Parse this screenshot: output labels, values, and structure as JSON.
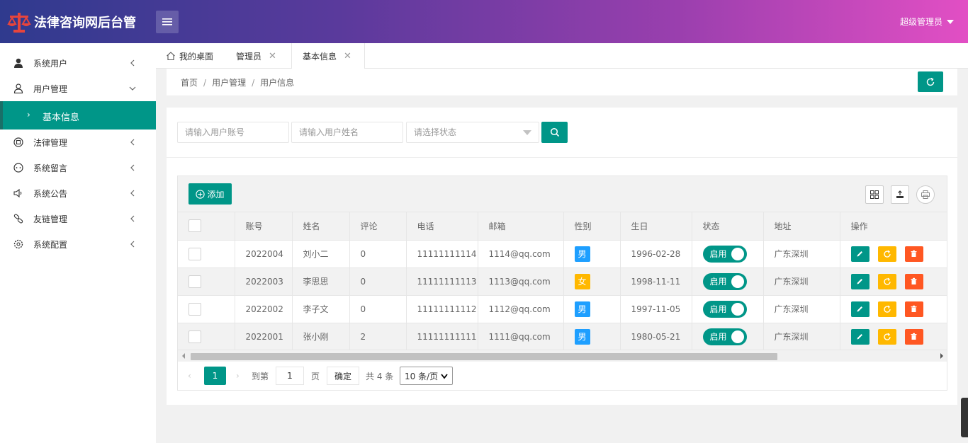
{
  "header": {
    "app_title": "法律咨询网后台管",
    "user_name": "超级管理员",
    "brand_color": "#d94534"
  },
  "sidebar": {
    "items": [
      {
        "label": "系统用户",
        "icon": "user-filled-icon"
      },
      {
        "label": "用户管理",
        "icon": "user-outline-icon"
      },
      {
        "label": "法律管理",
        "icon": "law-icon"
      },
      {
        "label": "系统留言",
        "icon": "message-icon"
      },
      {
        "label": "系统公告",
        "icon": "megaphone-icon"
      },
      {
        "label": "友链管理",
        "icon": "link-icon"
      },
      {
        "label": "系统配置",
        "icon": "gear-icon"
      }
    ],
    "sub_active": "基本信息"
  },
  "tabs": [
    {
      "label": "我的桌面"
    },
    {
      "label": "管理员"
    },
    {
      "label": "基本信息"
    }
  ],
  "breadcrumb": {
    "home": "首页",
    "level1": "用户管理",
    "level2": "用户信息",
    "separator": "/"
  },
  "search": {
    "account_placeholder": "请输入用户账号",
    "name_placeholder": "请输入用户姓名",
    "status_placeholder": "请选择状态"
  },
  "toolbar": {
    "add_label": "添加"
  },
  "table": {
    "columns": [
      "账号",
      "姓名",
      "评论",
      "电话",
      "邮箱",
      "性别",
      "生日",
      "状态",
      "地址",
      "操作"
    ],
    "rows": [
      {
        "account": "2022004",
        "name": "刘小二",
        "comments": "0",
        "phone": "11111111114",
        "email": "1114@qq.com",
        "gender": "男",
        "birthday": "1996-02-28",
        "status": "启用",
        "address": "广东深圳"
      },
      {
        "account": "2022003",
        "name": "李思思",
        "comments": "0",
        "phone": "11111111113",
        "email": "1113@qq.com",
        "gender": "女",
        "birthday": "1998-11-11",
        "status": "启用",
        "address": "广东深圳"
      },
      {
        "account": "2022002",
        "name": "李子文",
        "comments": "0",
        "phone": "11111111112",
        "email": "1112@qq.com",
        "gender": "男",
        "birthday": "1997-11-05",
        "status": "启用",
        "address": "广东深圳"
      },
      {
        "account": "2022001",
        "name": "张小刚",
        "comments": "2",
        "phone": "11111111111",
        "email": "1111@qq.com",
        "gender": "男",
        "birthday": "1980-05-21",
        "status": "启用",
        "address": "广东深圳"
      }
    ],
    "gender_colors": {
      "男": "#1e9fff",
      "女": "#ffb800"
    }
  },
  "pagination": {
    "current_page": "1",
    "goto_label": "到第",
    "goto_value": "1",
    "page_unit": "页",
    "confirm_label": "确定",
    "total_text": "共 4 条",
    "page_size": "10 条/页"
  },
  "colors": {
    "primary": "#009688",
    "edit": "#009688",
    "reset": "#ffb800",
    "delete": "#ff5722"
  }
}
